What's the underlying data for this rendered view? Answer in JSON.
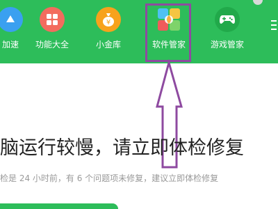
{
  "toolbar": {
    "items": [
      {
        "label": "加速",
        "icon": "speedup-icon"
      },
      {
        "label": "功能大全",
        "icon": "grid-icon"
      },
      {
        "label": "小金库",
        "icon": "money-bag-icon"
      },
      {
        "label": "软件管家",
        "icon": "software-manager-icon"
      },
      {
        "label": "游戏管家",
        "icon": "gamepad-icon"
      }
    ]
  },
  "status": {
    "headline": "脑运行较慢，请立即体检修复",
    "detail": "检是 24 小时前，有 6 个问题项未修复，建议立即体检修复"
  },
  "colors": {
    "toolbar_green": "#2dbd5a",
    "annotation_purple": "#8e4aa0"
  }
}
